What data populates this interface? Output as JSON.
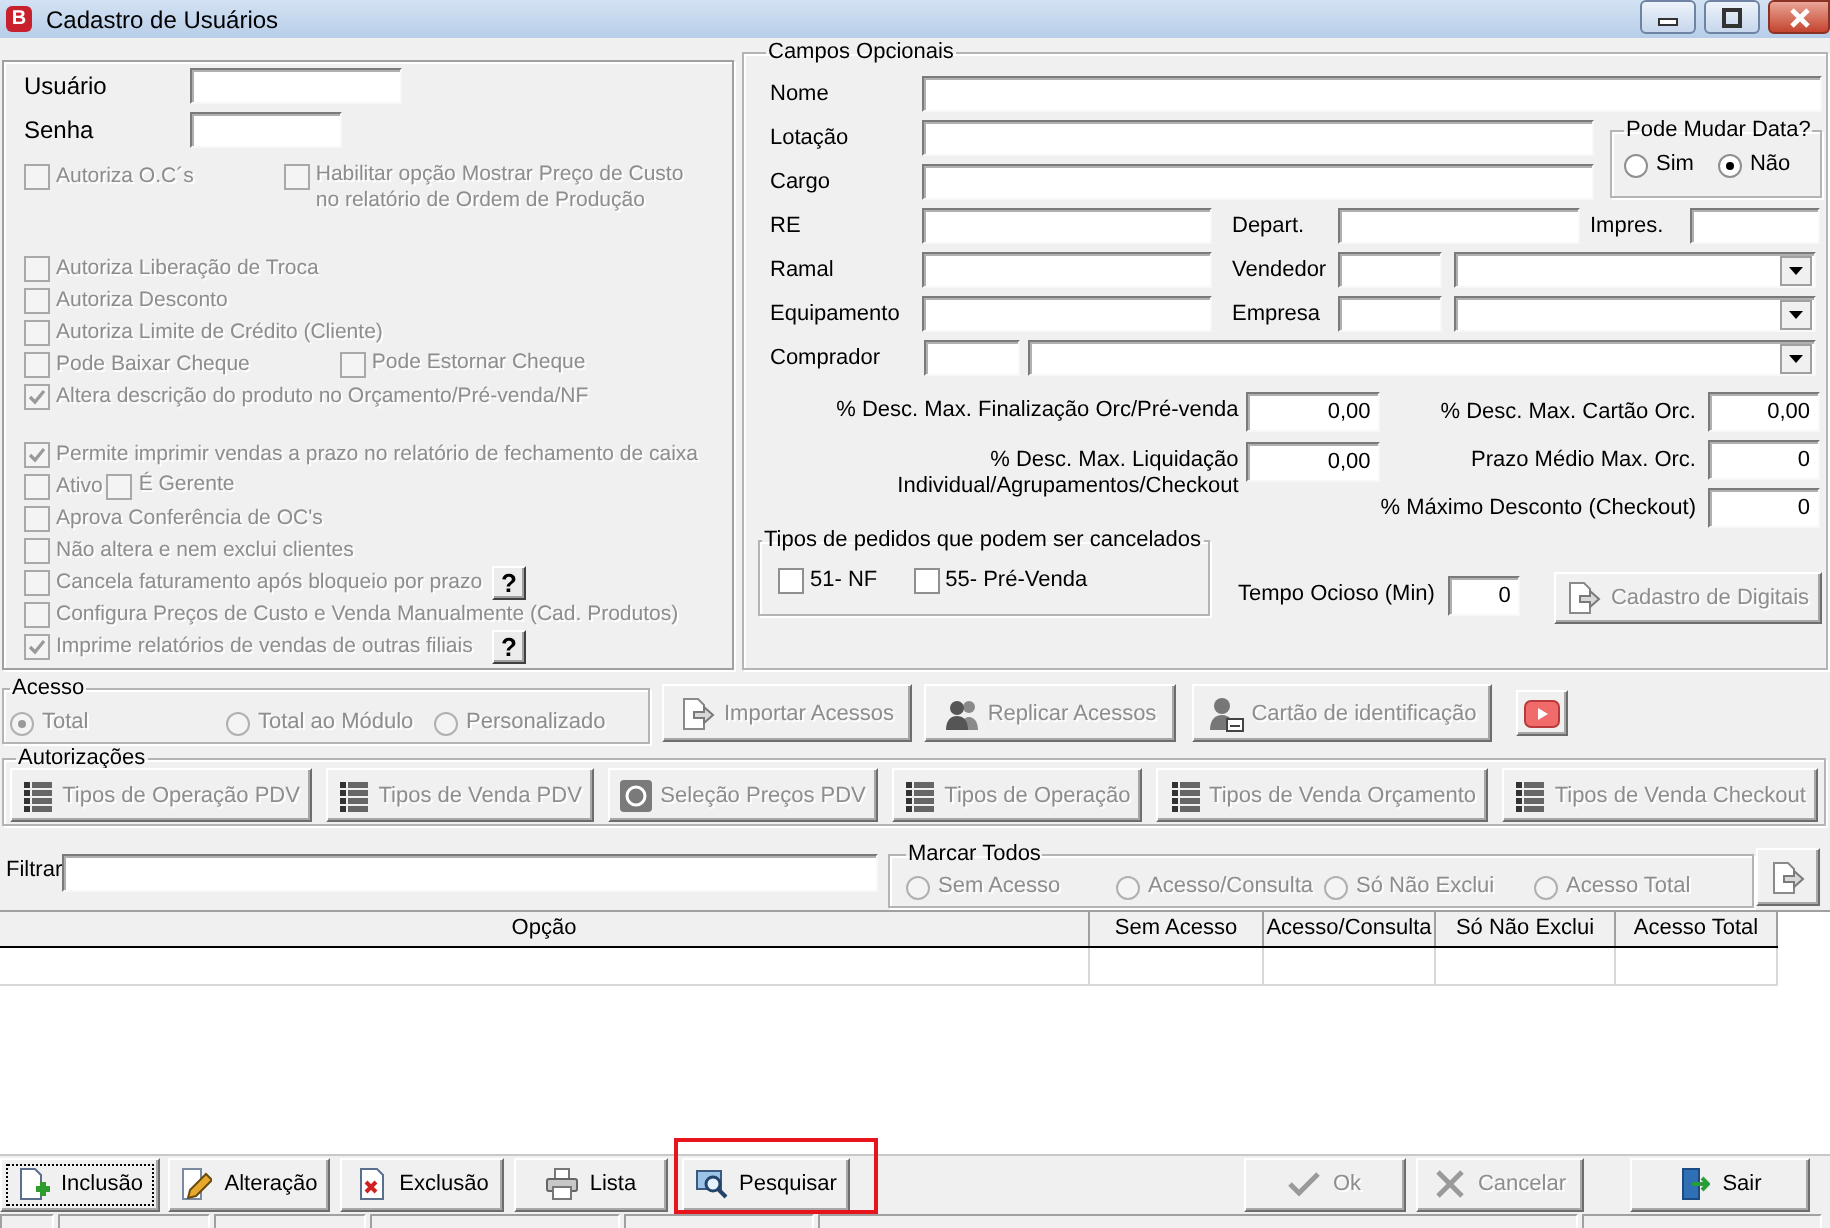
{
  "window": {
    "app_icon": "B",
    "title": "Cadastro de Usuários"
  },
  "credentials": [
    {
      "label": "Usuário"
    },
    {
      "label": "Senha"
    }
  ],
  "permissions": [
    {
      "rows": [
        {
          "kind": "pair",
          "items": [
            {
              "label": "Autoriza O.C´s",
              "checked": false,
              "disabled": true
            },
            {
              "label": "Habilitar opção Mostrar Preço de Custo no relatório de Ordem de Produção",
              "checked": false,
              "disabled": true
            }
          ]
        }
      ]
    },
    {
      "rows": [
        {
          "kind": "single",
          "items": [
            {
              "label": "Autoriza Liberação de Troca",
              "checked": false,
              "disabled": true
            }
          ]
        },
        {
          "kind": "single",
          "items": [
            {
              "label": "Autoriza Desconto",
              "checked": false,
              "disabled": true
            }
          ]
        },
        {
          "kind": "single",
          "items": [
            {
              "label": "Autoriza Limite de Crédito (Cliente)",
              "checked": false,
              "disabled": true
            }
          ]
        },
        {
          "kind": "pair",
          "items": [
            {
              "label": "Pode Baixar Cheque",
              "checked": false,
              "disabled": true
            },
            {
              "label": "Pode Estornar Cheque",
              "checked": false,
              "disabled": true
            }
          ]
        },
        {
          "kind": "single",
          "items": [
            {
              "label": "Altera descrição do produto no Orçamento/Pré-venda/NF",
              "checked": true,
              "disabled": true
            }
          ]
        }
      ]
    },
    {
      "rows": [
        {
          "kind": "single",
          "items": [
            {
              "label": "Permite imprimir vendas a prazo no relatório de fechamento de caixa",
              "checked": true,
              "disabled": true
            }
          ]
        },
        {
          "kind": "tight_pair",
          "items": [
            {
              "label": "Ativo",
              "checked": false,
              "disabled": true
            },
            {
              "label": "É Gerente",
              "checked": false,
              "disabled": true
            }
          ]
        },
        {
          "kind": "single",
          "items": [
            {
              "label": "Aprova Conferência de OC's",
              "checked": false,
              "disabled": true
            }
          ]
        },
        {
          "kind": "single",
          "items": [
            {
              "label": "Não altera e nem exclui clientes",
              "checked": false,
              "disabled": true
            }
          ]
        },
        {
          "kind": "single",
          "items": [
            {
              "label": "Cancela faturamento após bloqueio por prazo",
              "checked": false,
              "disabled": true,
              "help": "?"
            }
          ]
        },
        {
          "kind": "single",
          "items": [
            {
              "label": "Configura Preços de Custo e Venda Manualmente (Cad. Produtos)",
              "checked": false,
              "disabled": true
            }
          ]
        },
        {
          "kind": "single",
          "items": [
            {
              "label": "Imprime relatórios de vendas de outras filiais",
              "checked": true,
              "disabled": true,
              "help": "?"
            }
          ]
        }
      ]
    }
  ],
  "optional": {
    "title": "Campos Opcionais",
    "nome": {
      "label": "Nome"
    },
    "lotacao": {
      "label": "Lotação"
    },
    "cargo": {
      "label": "Cargo"
    },
    "date_change": {
      "title": "Pode Mudar Data?",
      "options": [
        {
          "label": "Sim",
          "selected": false
        },
        {
          "label": "Não",
          "selected": true
        }
      ]
    },
    "re": {
      "label": "RE"
    },
    "depart": {
      "label": "Depart."
    },
    "impres": {
      "label": "Impres."
    },
    "ramal": {
      "label": "Ramal"
    },
    "vendedor": {
      "label": "Vendedor"
    },
    "equipamento": {
      "label": "Equipamento"
    },
    "empresa": {
      "label": "Empresa"
    },
    "comprador": {
      "label": "Comprador"
    },
    "limits_left": [
      {
        "label": "% Desc. Max. Finalização Orc/Pré-venda",
        "value": "0,00"
      },
      {
        "label": "% Desc. Max. Liquidação Individual/Agrupamentos/Checkout",
        "value": "0,00"
      }
    ],
    "limits_right": [
      {
        "label": "% Desc. Max. Cartão Orc.",
        "value": "0,00"
      },
      {
        "label": "Prazo Médio Max. Orc.",
        "value": "0"
      },
      {
        "label": "% Máximo Desconto (Checkout)",
        "value": "0"
      }
    ],
    "cancel_types": {
      "title": "Tipos de pedidos que podem ser cancelados",
      "options": [
        {
          "label": "51- NF",
          "checked": false,
          "disabled": false
        },
        {
          "label": "55- Pré-Venda",
          "checked": false,
          "disabled": false
        }
      ]
    },
    "idle_time": {
      "label": "Tempo Ocioso (Min)",
      "value": "0"
    },
    "fingerprint_button": {
      "label": "Cadastro de Digitais",
      "disabled": true
    }
  },
  "access": {
    "title": "Acesso",
    "options": [
      {
        "label": "Total",
        "selected": true,
        "disabled": true
      },
      {
        "label": "Total ao Módulo",
        "selected": false,
        "disabled": true
      },
      {
        "label": "Personalizado",
        "selected": false,
        "disabled": true
      }
    ],
    "buttons": [
      {
        "label": "Importar Acessos",
        "kind": "import",
        "disabled": true
      },
      {
        "label": "Replicar Acessos",
        "kind": "users",
        "disabled": true
      },
      {
        "label": "Cartão de identificação",
        "kind": "card",
        "disabled": true
      },
      {
        "kind": "video",
        "disabled": false
      }
    ]
  },
  "authorizations": {
    "title": "Autorizações",
    "buttons": [
      {
        "label": "Tipos de Operação PDV",
        "kind": "list",
        "disabled": true
      },
      {
        "label": "Tipos de Venda PDV",
        "kind": "list",
        "disabled": true
      },
      {
        "label": "Seleção Preços PDV",
        "kind": "price",
        "disabled": true
      },
      {
        "label": "Tipos de Operação",
        "kind": "list",
        "disabled": true
      },
      {
        "label": "Tipos de Venda Orçamento",
        "kind": "list",
        "disabled": true
      },
      {
        "label": "Tipos de Venda Checkout",
        "kind": "list",
        "disabled": true
      }
    ]
  },
  "filter": {
    "label": "Filtrar",
    "mark_all": {
      "title": "Marcar Todos",
      "options": [
        {
          "label": "Sem Acesso",
          "selected": false,
          "disabled": true
        },
        {
          "label": "Acesso/Consulta",
          "selected": false,
          "disabled": true
        },
        {
          "label": "Só Não Exclui",
          "selected": false,
          "disabled": true
        },
        {
          "label": "Acesso Total",
          "selected": false,
          "disabled": true
        }
      ]
    }
  },
  "table": {
    "columns": [
      "Opção",
      "Sem Acesso",
      "Acesso/Consulta",
      "Só Não Exclui",
      "Acesso Total"
    ]
  },
  "toolbar": {
    "buttons": [
      {
        "label": "Inclusão",
        "kind": "add",
        "disabled": false,
        "focused": true,
        "highlighted": false
      },
      {
        "label": "Alteração",
        "kind": "edit",
        "disabled": false,
        "focused": false,
        "highlighted": false
      },
      {
        "label": "Exclusão",
        "kind": "delete",
        "disabled": false,
        "focused": false,
        "highlighted": false
      },
      {
        "label": "Lista",
        "kind": "print",
        "disabled": false,
        "focused": false,
        "highlighted": false
      },
      {
        "label": "Pesquisar",
        "kind": "search",
        "disabled": false,
        "focused": false,
        "highlighted": true
      },
      {
        "label": "Ok",
        "kind": "ok",
        "disabled": true,
        "focused": false,
        "highlighted": false
      },
      {
        "label": "Cancelar",
        "kind": "cancel",
        "disabled": true,
        "focused": false,
        "highlighted": false
      },
      {
        "label": "Sair",
        "kind": "exit",
        "disabled": false,
        "focused": false,
        "highlighted": false
      }
    ]
  }
}
